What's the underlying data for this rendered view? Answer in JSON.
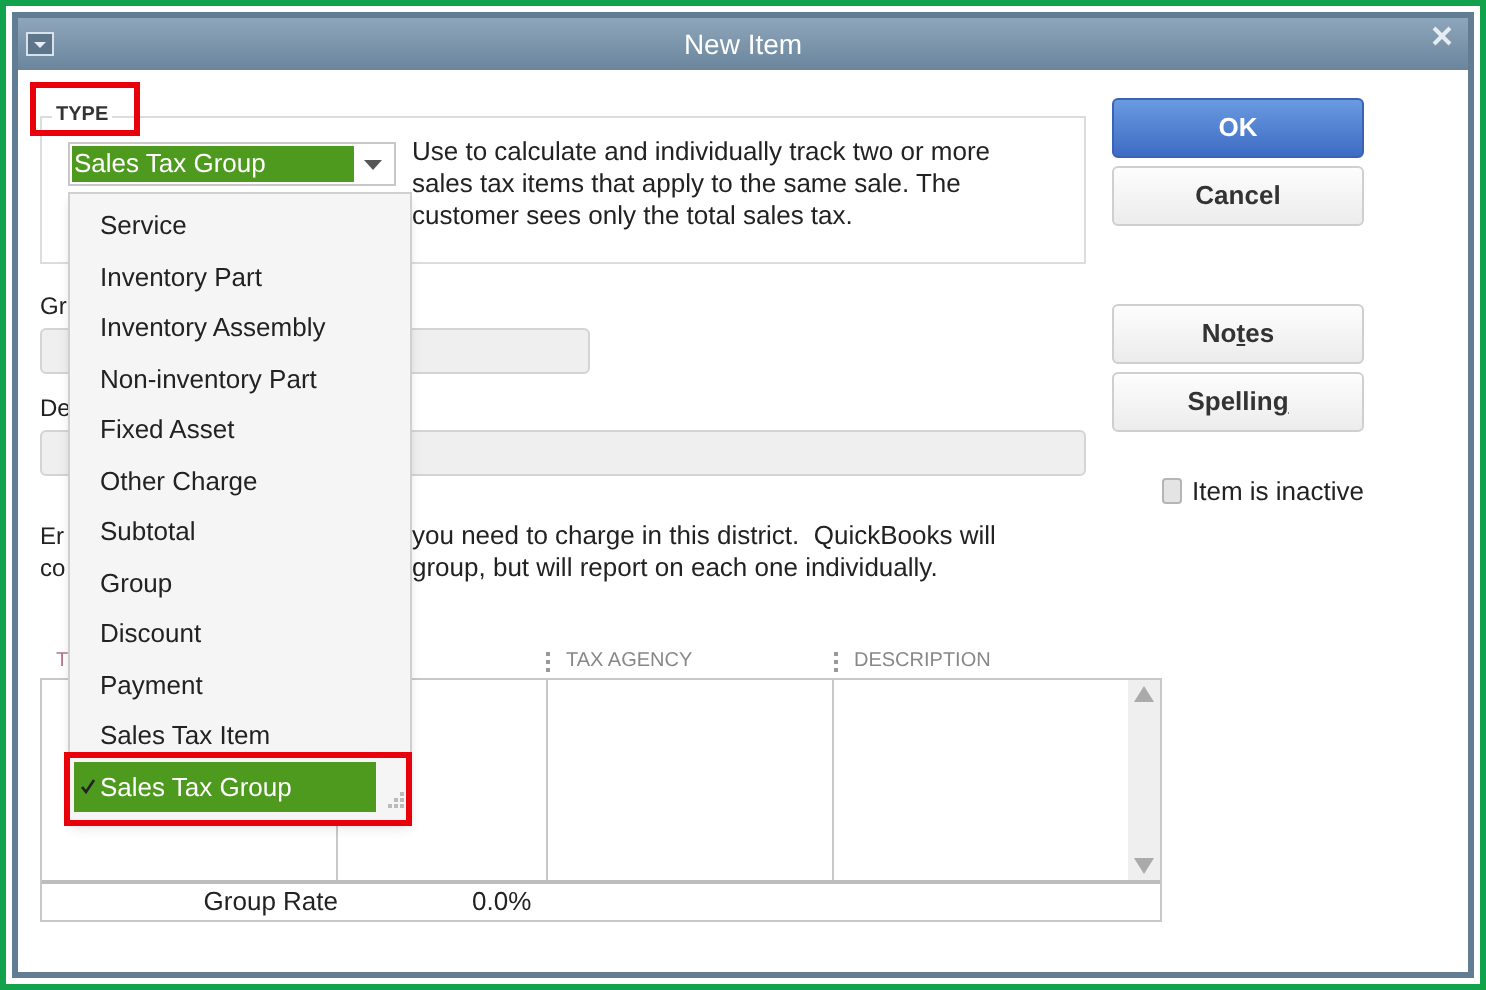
{
  "window": {
    "title": "New Item"
  },
  "type_group": {
    "legend": "TYPE",
    "selected_type": "Sales Tax Group",
    "description_lines": [
      "Use to calculate and individually track two or more",
      "sales tax items that apply to the same sale. The",
      "customer sees only the total sales tax."
    ]
  },
  "dropdown": {
    "items": [
      {
        "label": "Service",
        "selected": false
      },
      {
        "label": "Inventory Part",
        "selected": false
      },
      {
        "label": "Inventory Assembly",
        "selected": false
      },
      {
        "label": "Non-inventory Part",
        "selected": false
      },
      {
        "label": "Fixed Asset",
        "selected": false
      },
      {
        "label": "Other Charge",
        "selected": false
      },
      {
        "label": "Subtotal",
        "selected": false
      },
      {
        "label": "Group",
        "selected": false
      },
      {
        "label": "Discount",
        "selected": false
      },
      {
        "label": "Payment",
        "selected": false
      },
      {
        "label": "Sales Tax Item",
        "selected": false
      },
      {
        "label": "Sales Tax Group",
        "selected": true
      }
    ]
  },
  "fields": [
    {
      "label": "Gr",
      "kind": "short"
    },
    {
      "label": "De",
      "kind": "long"
    }
  ],
  "note_lines": [
    {
      "start": "Er",
      "end": "you need to charge in this district.  QuickBooks will"
    },
    {
      "start": "co",
      "end": "group, but will report on each one individually."
    }
  ],
  "table": {
    "headers": {
      "column_1": "T",
      "tax_agency": "TAX AGENCY",
      "description": "DESCRIPTION"
    },
    "footer": {
      "label": "Group Rate",
      "rate": "0.0%"
    }
  },
  "buttons": [
    {
      "kind": "primary",
      "before": "OK"
    },
    {
      "kind": "normal",
      "before": "Cancel"
    },
    {
      "kind": "spacer"
    },
    {
      "kind": "normal",
      "before": "No",
      "key": "t",
      "after": "es"
    },
    {
      "kind": "normal",
      "before": "Spellin",
      "key": "g"
    }
  ],
  "inactive": {
    "label": "Item is inactive",
    "checked": false
  }
}
